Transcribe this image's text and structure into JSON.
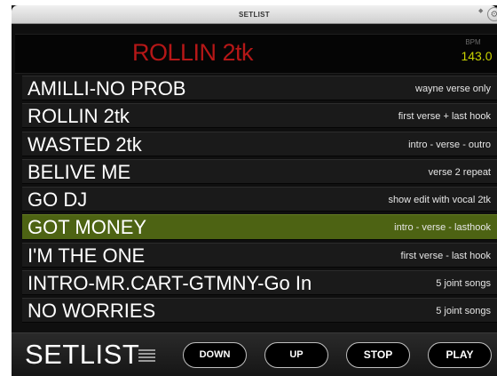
{
  "window": {
    "title": "SETLIST"
  },
  "header": {
    "now_playing": "ROLLIN 2tk",
    "bpm_label": "BPM",
    "bpm_value": "143.0"
  },
  "setlist": [
    {
      "song": "AMILLI-NO PROB",
      "note": "wayne verse only",
      "selected": false
    },
    {
      "song": "ROLLIN 2tk",
      "note": "first verse + last hook",
      "selected": false
    },
    {
      "song": "WASTED 2tk",
      "note": "intro - verse - outro",
      "selected": false
    },
    {
      "song": "BELIVE ME",
      "note": "verse 2 repeat",
      "selected": false
    },
    {
      "song": "GO DJ",
      "note": "show edit with vocal 2tk",
      "selected": false
    },
    {
      "song": "GOT MONEY",
      "note": "intro - verse - lasthook",
      "selected": true
    },
    {
      "song": "I'M THE ONE",
      "note": "first verse - last hook",
      "selected": false
    },
    {
      "song": "INTRO-MR.CART-GTMNY-Go In",
      "note": "5 joint songs",
      "selected": false
    },
    {
      "song": "NO WORRIES",
      "note": "5 joint songs",
      "selected": false
    }
  ],
  "footer": {
    "brand": "SETLIST",
    "menu_icon": "menu-lines-icon",
    "buttons": {
      "down": "DOWN",
      "up": "UP",
      "stop": "STOP",
      "play": "PLAY"
    }
  },
  "colors": {
    "now_playing": "#b51717",
    "bpm_value": "#c8d200",
    "selected_row": "#4d6313",
    "background": "#0f0f0f"
  }
}
